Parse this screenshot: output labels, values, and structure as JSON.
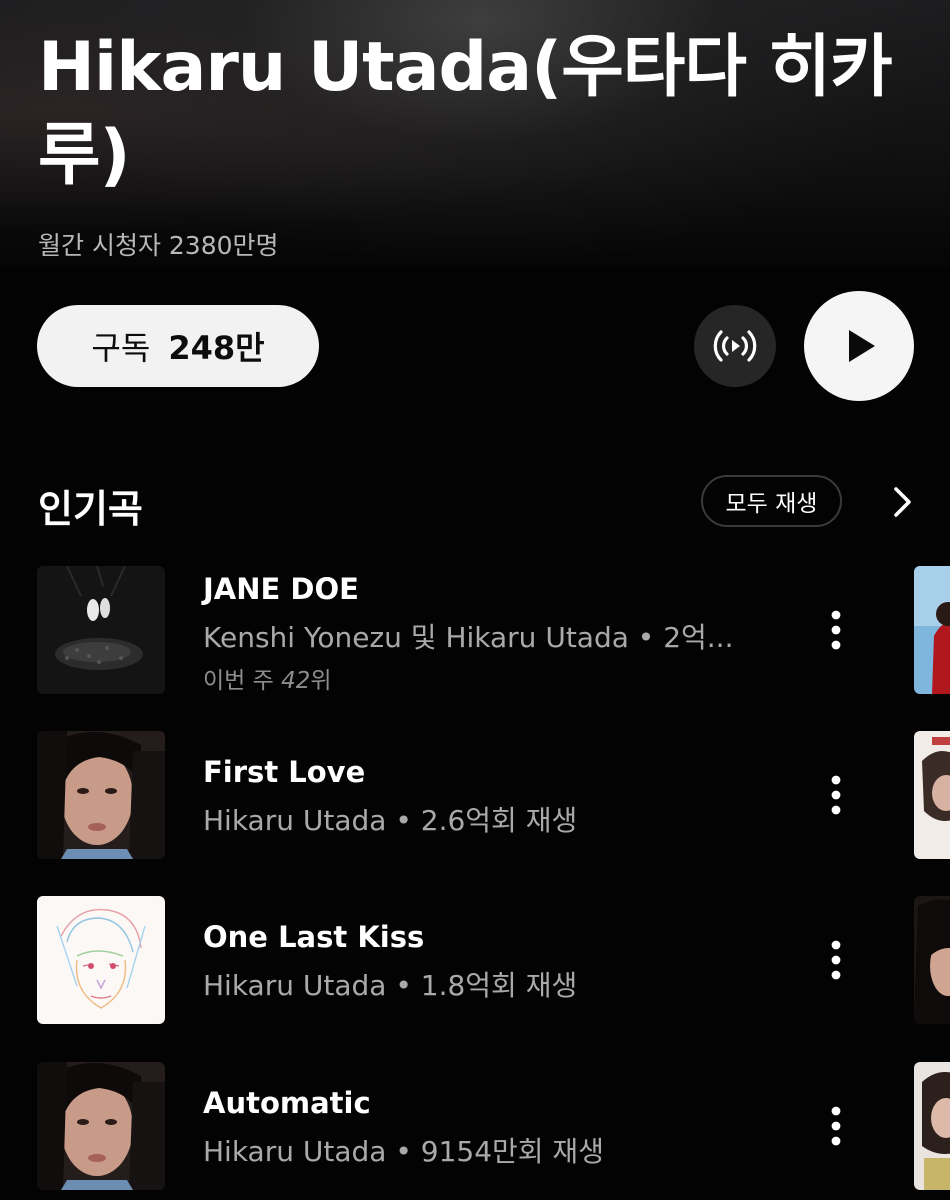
{
  "artist": {
    "name": "Hikaru Utada(우타다 히카루)",
    "monthly_listeners": "월간 시청자 2380만명"
  },
  "actions": {
    "subscribe_label": "구독",
    "subscribe_count": "248만",
    "radio_icon": "radio-broadcast-icon",
    "play_icon": "play-icon"
  },
  "popular": {
    "title": "인기곡",
    "play_all_label": "모두 재생",
    "more_icon": "chevron-right-icon",
    "tracks": [
      {
        "title": "JANE DOE",
        "subtitle": "Kenshi Yonezu 및 Hikaru Utada • 2억...",
        "chart_prefix": "이번 주 ",
        "chart_rank": "42",
        "chart_suffix": "위"
      },
      {
        "title": "First Love",
        "subtitle": "Hikaru Utada • 2.6억회 재생"
      },
      {
        "title": "One Last Kiss",
        "subtitle": "Hikaru Utada • 1.8억회 재생"
      },
      {
        "title": "Automatic",
        "subtitle": "Hikaru Utada • 9154만회 재생"
      }
    ]
  },
  "colors": {
    "background": "#030303",
    "primary_text": "#ffffff",
    "secondary_text": "#a9a9a9",
    "button_light": "#f2f2f2",
    "button_dark": "#262626"
  }
}
